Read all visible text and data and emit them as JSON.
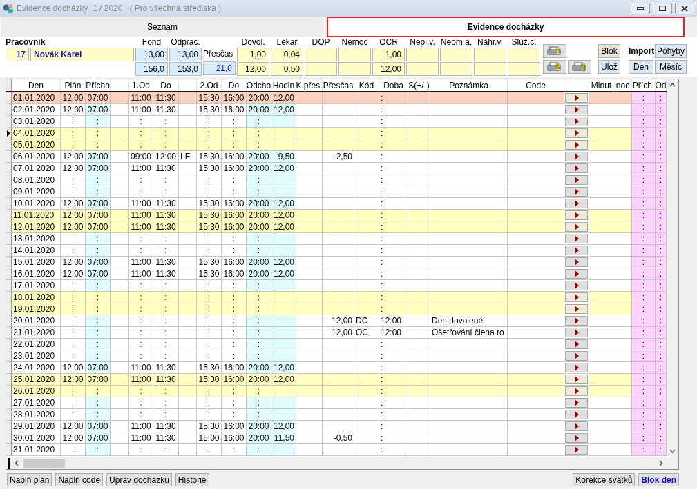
{
  "window": {
    "title": "Evidence docházky  1 / 2020   ( Pro všechna střediska )"
  },
  "tabs": [
    {
      "label": "Seznam",
      "selected": false
    },
    {
      "label": "Evidence docházky",
      "selected": true
    }
  ],
  "employee": {
    "label": "Pracovník",
    "number": "17",
    "name": "Novák Karel"
  },
  "stats": [
    {
      "label": "Fond",
      "kind": "hours",
      "values": [
        "13,00",
        "156,0"
      ]
    },
    {
      "label": "Odprac.",
      "kind": "hours",
      "values": [
        "13,00",
        "153,0"
      ]
    },
    {
      "label": "Přesčas",
      "kind": "inline",
      "values": [
        "21,0"
      ]
    },
    {
      "label": "Dovol.",
      "kind": "absence",
      "values": [
        "1,00",
        "12,00"
      ]
    },
    {
      "label": "Lékař",
      "kind": "absence",
      "values": [
        "0,04",
        "0,50"
      ]
    },
    {
      "label": "DOP",
      "kind": "absence"
    },
    {
      "label": "Nemoc",
      "kind": "absence"
    },
    {
      "label": "OCR",
      "kind": "absence",
      "values": [
        "1,00",
        "12,00"
      ]
    },
    {
      "label": "Nepl.v.",
      "kind": "absence"
    },
    {
      "label": "Neom.a.",
      "kind": "absence"
    },
    {
      "label": "Náhr.v.",
      "kind": "absence"
    },
    {
      "label": "Služ.c.",
      "kind": "absence"
    }
  ],
  "print_buttons": [
    "1",
    "2",
    "3"
  ],
  "actions": {
    "blok": "Blok",
    "uloz": "Ulož",
    "import_label": "Import",
    "pohyby": "Pohyby",
    "den": "Den",
    "mesic": "Měsíc"
  },
  "table": {
    "columns": [
      "Den",
      "Plán",
      "Přícho",
      null,
      "1.Od",
      "Do",
      null,
      "2.Od",
      "Do",
      "Odcho",
      "Hodin",
      "K.přes.",
      "Přesčas",
      "Kód",
      "Doba",
      "S(+/-)",
      "Poznámka",
      "Code",
      null,
      "Minut_noc",
      "Přích.",
      "Od"
    ],
    "rows": [
      {
        "kind": "holiday",
        "selected": false,
        "cells": [
          "01.01.2020",
          "12:00",
          "07:00",
          null,
          "11:00",
          "11:30",
          null,
          "15:30",
          "16:00",
          "20:00",
          "12,00",
          null,
          null,
          null,
          ":",
          null,
          null,
          null,
          null,
          null,
          ":",
          ":"
        ]
      },
      {
        "kind": "workday",
        "selected": false,
        "cells": [
          "02.01.2020",
          "12:00",
          "07:00",
          null,
          "11:00",
          "11:30",
          null,
          "15:30",
          "16:00",
          "20:00",
          "12,00",
          null,
          null,
          null,
          ":",
          null,
          null,
          null,
          null,
          null,
          ":",
          ":"
        ]
      },
      {
        "kind": "workday",
        "selected": false,
        "cells": [
          "03.01.2020",
          ":",
          ":",
          null,
          ":",
          ":",
          null,
          ":",
          ":",
          ":",
          null,
          null,
          null,
          null,
          ":",
          null,
          null,
          null,
          null,
          null,
          ":",
          ":"
        ]
      },
      {
        "kind": "weekend",
        "selected": true,
        "cells": [
          "04.01.2020",
          ":",
          ":",
          null,
          ":",
          ":",
          null,
          ":",
          ":",
          ":",
          null,
          null,
          null,
          null,
          ":",
          null,
          null,
          null,
          null,
          null,
          ":",
          ":"
        ]
      },
      {
        "kind": "weekend",
        "selected": false,
        "cells": [
          "05.01.2020",
          ":",
          ":",
          null,
          ":",
          ":",
          null,
          ":",
          ":",
          ":",
          null,
          null,
          null,
          null,
          ":",
          null,
          null,
          null,
          null,
          null,
          ":",
          ":"
        ]
      },
      {
        "kind": "workday",
        "selected": false,
        "cells": [
          "06.01.2020",
          "12:00",
          "07:00",
          null,
          "09:00",
          "12:00",
          "LE",
          "15:30",
          "16:00",
          "20:00",
          "9,50",
          null,
          "-2,50",
          null,
          ":",
          null,
          null,
          null,
          null,
          null,
          ":",
          ":"
        ]
      },
      {
        "kind": "workday",
        "selected": false,
        "cells": [
          "07.01.2020",
          "12:00",
          "07:00",
          null,
          "11:00",
          "11:30",
          null,
          "15:30",
          "16:00",
          "20:00",
          "12,00",
          null,
          null,
          null,
          ":",
          null,
          null,
          null,
          null,
          null,
          ":",
          ":"
        ]
      },
      {
        "kind": "workday",
        "selected": false,
        "cells": [
          "08.01.2020",
          ":",
          ":",
          null,
          ":",
          ":",
          null,
          ":",
          ":",
          ":",
          null,
          null,
          null,
          null,
          ":",
          null,
          null,
          null,
          null,
          null,
          ":",
          ":"
        ]
      },
      {
        "kind": "workday",
        "selected": false,
        "cells": [
          "09.01.2020",
          ":",
          ":",
          null,
          ":",
          ":",
          null,
          ":",
          ":",
          ":",
          null,
          null,
          null,
          null,
          ":",
          null,
          null,
          null,
          null,
          null,
          ":",
          ":"
        ]
      },
      {
        "kind": "workday",
        "selected": false,
        "cells": [
          "10.01.2020",
          "12:00",
          "07:00",
          null,
          "11:00",
          "11:30",
          null,
          "15:30",
          "16:00",
          "20:00",
          "12,00",
          null,
          null,
          null,
          ":",
          null,
          null,
          null,
          null,
          null,
          ":",
          ":"
        ]
      },
      {
        "kind": "weekend",
        "selected": false,
        "cells": [
          "11.01.2020",
          "12:00",
          "07:00",
          null,
          "11:00",
          "11:30",
          null,
          "15:30",
          "16:00",
          "20:00",
          "12,00",
          null,
          null,
          null,
          ":",
          null,
          null,
          null,
          null,
          null,
          ":",
          ":"
        ]
      },
      {
        "kind": "weekend",
        "selected": false,
        "cells": [
          "12.01.2020",
          "12:00",
          "07:00",
          null,
          "11:00",
          "11:30",
          null,
          "15:30",
          "16:00",
          "20:00",
          "12,00",
          null,
          null,
          null,
          ":",
          null,
          null,
          null,
          null,
          null,
          ":",
          ":"
        ]
      },
      {
        "kind": "workday",
        "selected": false,
        "cells": [
          "13.01.2020",
          ":",
          ":",
          null,
          ":",
          ":",
          null,
          ":",
          ":",
          ":",
          null,
          null,
          null,
          null,
          ":",
          null,
          null,
          null,
          null,
          null,
          ":",
          ":"
        ]
      },
      {
        "kind": "workday",
        "selected": false,
        "cells": [
          "14.01.2020",
          ":",
          ":",
          null,
          ":",
          ":",
          null,
          ":",
          ":",
          ":",
          null,
          null,
          null,
          null,
          ":",
          null,
          null,
          null,
          null,
          null,
          ":",
          ":"
        ]
      },
      {
        "kind": "workday",
        "selected": false,
        "cells": [
          "15.01.2020",
          "12:00",
          "07:00",
          null,
          "11:00",
          "11:30",
          null,
          "15:30",
          "16:00",
          "20:00",
          "12,00",
          null,
          null,
          null,
          ":",
          null,
          null,
          null,
          null,
          null,
          ":",
          ":"
        ]
      },
      {
        "kind": "workday",
        "selected": false,
        "cells": [
          "16.01.2020",
          "12:00",
          "07:00",
          null,
          "11:00",
          "11:30",
          null,
          "15:30",
          "16:00",
          "20:00",
          "12,00",
          null,
          null,
          null,
          ":",
          null,
          null,
          null,
          null,
          null,
          ":",
          ":"
        ]
      },
      {
        "kind": "workday",
        "selected": false,
        "cells": [
          "17.01.2020",
          ":",
          ":",
          null,
          ":",
          ":",
          null,
          ":",
          ":",
          ":",
          null,
          null,
          null,
          null,
          ":",
          null,
          null,
          null,
          null,
          null,
          ":",
          ":"
        ]
      },
      {
        "kind": "weekend",
        "selected": false,
        "cells": [
          "18.01.2020",
          ":",
          ":",
          null,
          ":",
          ":",
          null,
          ":",
          ":",
          ":",
          null,
          null,
          null,
          null,
          ":",
          null,
          null,
          null,
          null,
          null,
          ":",
          ":"
        ]
      },
      {
        "kind": "weekend",
        "selected": false,
        "cells": [
          "19.01.2020",
          ":",
          ":",
          null,
          ":",
          ":",
          null,
          ":",
          ":",
          ":",
          null,
          null,
          null,
          null,
          ":",
          null,
          null,
          null,
          null,
          null,
          ":",
          ":"
        ]
      },
      {
        "kind": "workday",
        "selected": false,
        "cells": [
          "20.01.2020",
          ":",
          ":",
          null,
          ":",
          ":",
          null,
          ":",
          ":",
          ":",
          null,
          null,
          "12,00",
          "DC",
          "12:00",
          null,
          "Den dovolené",
          null,
          null,
          null,
          ":",
          ":"
        ]
      },
      {
        "kind": "workday",
        "selected": false,
        "cells": [
          "21.01.2020",
          ":",
          ":",
          null,
          ":",
          ":",
          null,
          ":",
          ":",
          ":",
          null,
          null,
          "12,00",
          "OC",
          "12:00",
          null,
          "Ošetřování člena ro",
          null,
          null,
          null,
          ":",
          ":"
        ]
      },
      {
        "kind": "workday",
        "selected": false,
        "cells": [
          "22.01.2020",
          ":",
          ":",
          null,
          ":",
          ":",
          null,
          ":",
          ":",
          ":",
          null,
          null,
          null,
          null,
          ":",
          null,
          null,
          null,
          null,
          null,
          ":",
          ":"
        ]
      },
      {
        "kind": "workday",
        "selected": false,
        "cells": [
          "23.01.2020",
          ":",
          ":",
          null,
          ":",
          ":",
          null,
          ":",
          ":",
          ":",
          null,
          null,
          null,
          null,
          ":",
          null,
          null,
          null,
          null,
          null,
          ":",
          ":"
        ]
      },
      {
        "kind": "workday",
        "selected": false,
        "cells": [
          "24.01.2020",
          "12:00",
          "07:00",
          null,
          "11:00",
          "11:30",
          null,
          "15:30",
          "16:00",
          "20:00",
          "12,00",
          null,
          null,
          null,
          ":",
          null,
          null,
          null,
          null,
          null,
          ":",
          ":"
        ]
      },
      {
        "kind": "weekend",
        "selected": false,
        "cells": [
          "25.01.2020",
          "12:00",
          "07:00",
          null,
          "11:00",
          "11:30",
          null,
          "15:30",
          "16:00",
          "20:00",
          "12,00",
          null,
          null,
          null,
          ":",
          null,
          null,
          null,
          null,
          null,
          ":",
          ":"
        ]
      },
      {
        "kind": "weekend",
        "selected": false,
        "cells": [
          "26.01.2020",
          ":",
          ":",
          null,
          ":",
          ":",
          null,
          ":",
          ":",
          ":",
          null,
          null,
          null,
          null,
          ":",
          null,
          null,
          null,
          null,
          null,
          ":",
          ":"
        ]
      },
      {
        "kind": "workday",
        "selected": false,
        "cells": [
          "27.01.2020",
          ":",
          ":",
          null,
          ":",
          ":",
          null,
          ":",
          ":",
          ":",
          null,
          null,
          null,
          null,
          ":",
          null,
          null,
          null,
          null,
          null,
          ":",
          ":"
        ]
      },
      {
        "kind": "workday",
        "selected": false,
        "cells": [
          "28.01.2020",
          ":",
          ":",
          null,
          ":",
          ":",
          null,
          ":",
          ":",
          ":",
          null,
          null,
          null,
          null,
          ":",
          null,
          null,
          null,
          null,
          null,
          ":",
          ":"
        ]
      },
      {
        "kind": "workday",
        "selected": false,
        "cells": [
          "29.01.2020",
          "12:00",
          "07:00",
          null,
          "11:00",
          "11:30",
          null,
          "15:30",
          "16:00",
          "20:00",
          "12,00",
          null,
          null,
          null,
          ":",
          null,
          null,
          null,
          null,
          null,
          ":",
          ":"
        ]
      },
      {
        "kind": "workday",
        "selected": false,
        "cells": [
          "30.01.2020",
          "12:00",
          "07:00",
          null,
          "11:00",
          "11:30",
          null,
          "15:00",
          "16:00",
          "20:00",
          "11,50",
          null,
          "-0,50",
          null,
          ":",
          null,
          null,
          null,
          null,
          null,
          ":",
          ":"
        ]
      },
      {
        "kind": "workday",
        "selected": false,
        "cells": [
          "31.01.2020",
          ":",
          ":",
          null,
          ":",
          ":",
          null,
          ":",
          ":",
          ":",
          null,
          null,
          null,
          null,
          ":",
          null,
          null,
          null,
          null,
          null,
          ":",
          ":"
        ]
      }
    ]
  },
  "footer": {
    "left": [
      "Naplň plán",
      "Naplň code",
      "Uprav docházku",
      "Historie"
    ],
    "right": [
      {
        "label": "Korekce svátků",
        "kind": "normal"
      },
      {
        "label": "Blok den",
        "kind": "accent"
      }
    ]
  }
}
